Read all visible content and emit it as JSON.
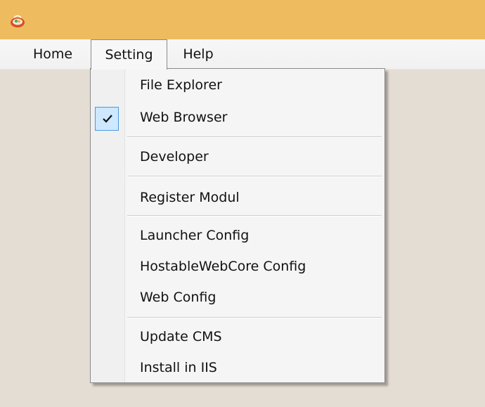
{
  "menubar": {
    "home": "Home",
    "setting": "Setting",
    "help": "Help"
  },
  "setting_menu": {
    "file_explorer": "File Explorer",
    "web_browser": "Web Browser",
    "developer": "Developer",
    "register_modul": "Register Modul",
    "launcher_config": "Launcher Config",
    "hostable_webcore_config": "HostableWebCore Config",
    "web_config": "Web Config",
    "update_cms": "Update CMS",
    "install_in_iis": "Install in IIS"
  },
  "colors": {
    "titlebar": "#eebc5f",
    "client_background": "#e4ddd3",
    "check_highlight": "#cde8ff",
    "check_border": "#4a9ae0"
  },
  "icons": {
    "app": "app-icon",
    "check": "checkmark-icon"
  }
}
